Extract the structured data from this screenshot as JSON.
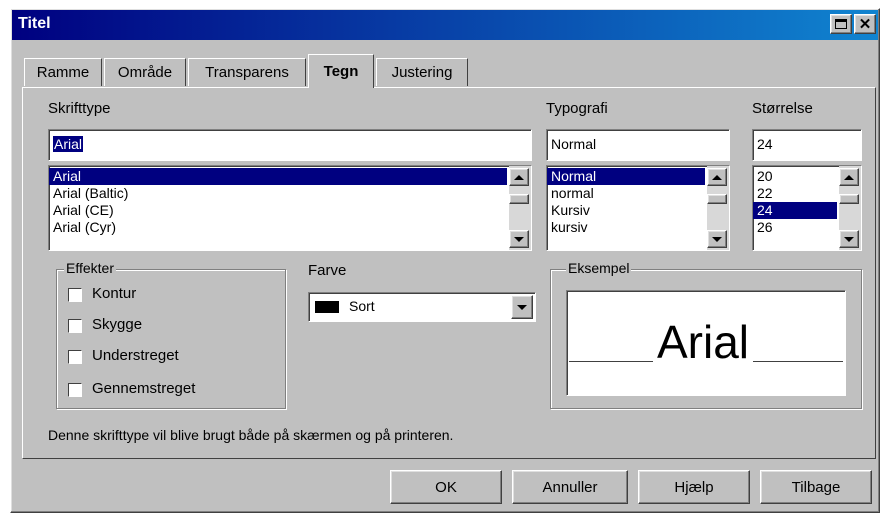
{
  "window": {
    "title": "Titel"
  },
  "tabs": [
    {
      "label": "Ramme"
    },
    {
      "label": "Område"
    },
    {
      "label": "Transparens"
    },
    {
      "label": "Tegn"
    },
    {
      "label": "Justering"
    }
  ],
  "font": {
    "label": "Skrifttype",
    "value": "Arial",
    "items": [
      "Arial",
      "Arial (Baltic)",
      "Arial (CE)",
      "Arial (Cyr)"
    ],
    "selected_index": 0
  },
  "typeface": {
    "label": "Typografi",
    "value": "Normal",
    "items": [
      "Normal",
      "normal",
      "Kursiv",
      "kursiv"
    ],
    "selected_index": 0
  },
  "size": {
    "label": "Størrelse",
    "value": "24",
    "items": [
      "20",
      "22",
      "24",
      "26"
    ],
    "selected_index": 2
  },
  "effects": {
    "label": "Effekter",
    "items": [
      "Kontur",
      "Skygge",
      "Understreget",
      "Gennemstreget"
    ]
  },
  "color": {
    "label": "Farve",
    "value": "Sort",
    "swatch": "#000000"
  },
  "preview": {
    "label": "Eksempel",
    "text": "Arial"
  },
  "description": "Denne skrifttype vil blive brugt både på skærmen og på printeren.",
  "buttons": {
    "ok": "OK",
    "cancel": "Annuller",
    "help": "Hjælp",
    "back": "Tilbage"
  },
  "colors": {
    "titlebar": "#000080",
    "face": "#c0c0c0",
    "selection": "#000080"
  }
}
